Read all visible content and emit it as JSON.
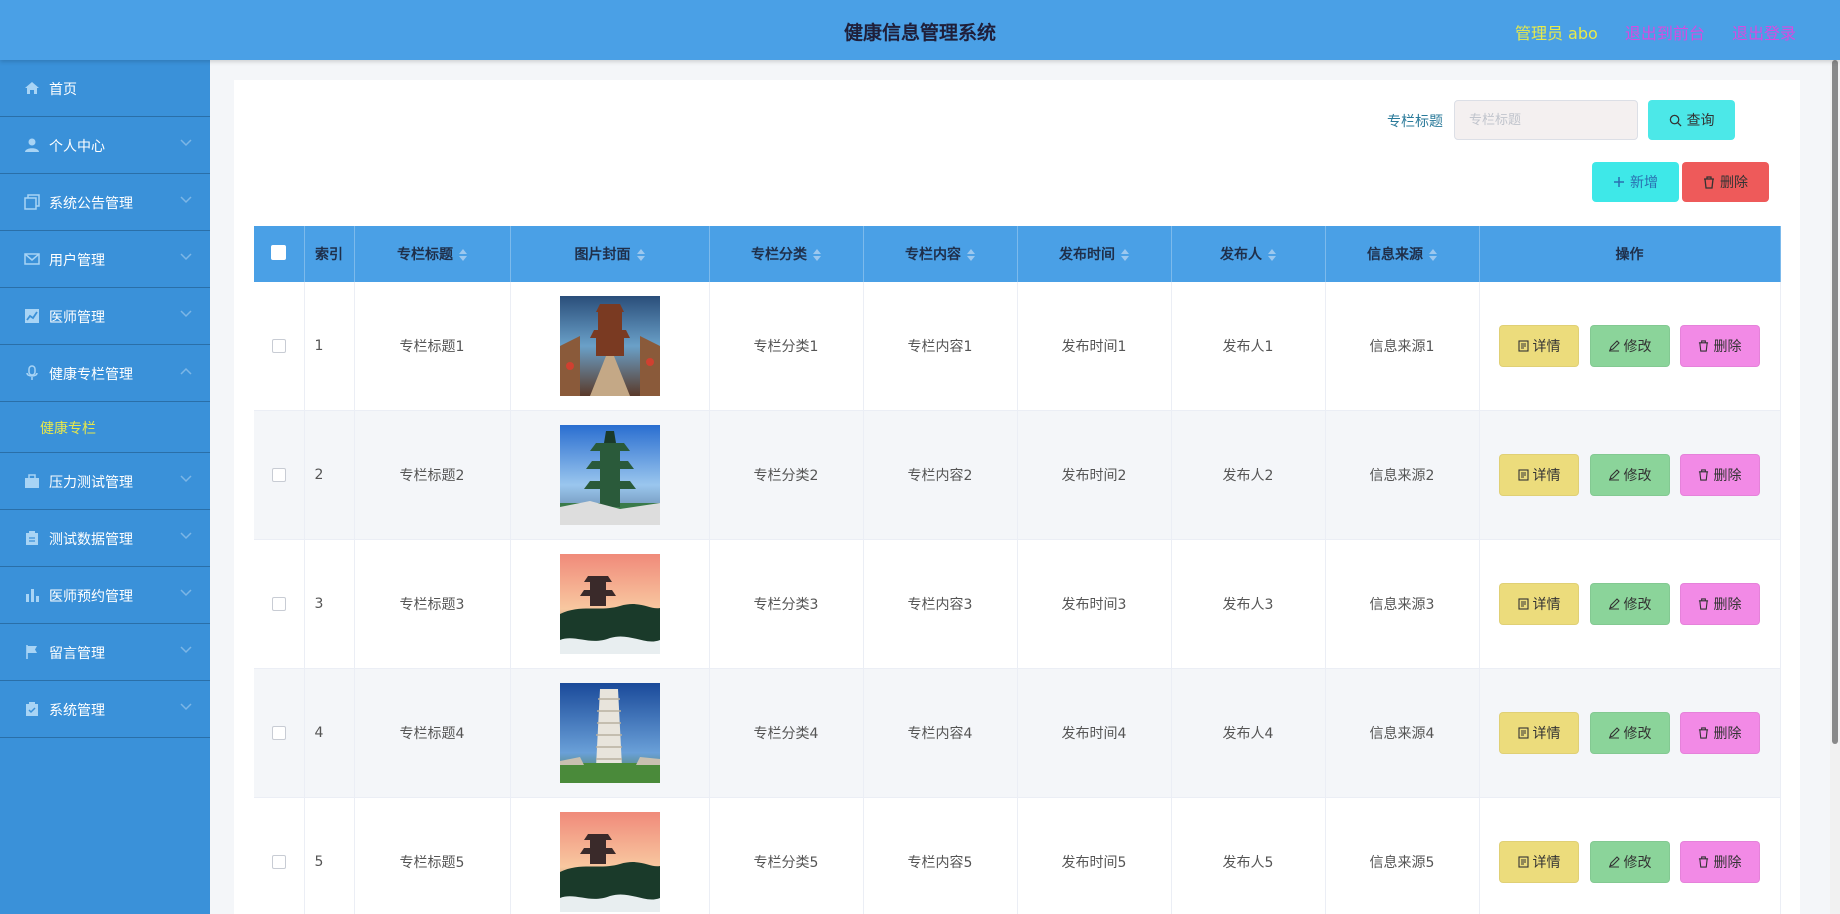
{
  "header": {
    "title": "健康信息管理系统",
    "admin": "管理员 abo",
    "front": "退出到前台",
    "logout": "退出登录"
  },
  "sidebar": {
    "items": [
      {
        "label": "首页",
        "icon": "home-icon"
      },
      {
        "label": "个人中心",
        "icon": "user-icon"
      },
      {
        "label": "系统公告管理",
        "icon": "document-icon"
      },
      {
        "label": "用户管理",
        "icon": "mail-icon"
      },
      {
        "label": "医师管理",
        "icon": "chart-icon"
      },
      {
        "label": "健康专栏管理",
        "icon": "microphone-icon"
      },
      {
        "label": "压力测试管理",
        "icon": "briefcase-icon"
      },
      {
        "label": "测试数据管理",
        "icon": "clipboard-icon"
      },
      {
        "label": "医师预约管理",
        "icon": "bar-chart-icon"
      },
      {
        "label": "留言管理",
        "icon": "flag-icon"
      },
      {
        "label": "系统管理",
        "icon": "check-clipboard-icon"
      }
    ],
    "sub_active": "健康专栏",
    "accent": "#e8e84a"
  },
  "search": {
    "label": "专栏标题",
    "placeholder": "专栏标题",
    "query_label": "查询"
  },
  "toolbar": {
    "add_label": "新增",
    "delete_label": "删除"
  },
  "table": {
    "columns": [
      "索引",
      "专栏标题",
      "图片封面",
      "专栏分类",
      "专栏内容",
      "发布时间",
      "发布人",
      "信息来源",
      "操作"
    ],
    "rows": [
      {
        "index": "1",
        "title": "专栏标题1",
        "category": "专栏分类1",
        "content": "专栏内容1",
        "time": "发布时间1",
        "publisher": "发布人1",
        "source": "信息来源1"
      },
      {
        "index": "2",
        "title": "专栏标题2",
        "category": "专栏分类2",
        "content": "专栏内容2",
        "time": "发布时间2",
        "publisher": "发布人2",
        "source": "信息来源2"
      },
      {
        "index": "3",
        "title": "专栏标题3",
        "category": "专栏分类3",
        "content": "专栏内容3",
        "time": "发布时间3",
        "publisher": "发布人3",
        "source": "信息来源3"
      },
      {
        "index": "4",
        "title": "专栏标题4",
        "category": "专栏分类4",
        "content": "专栏内容4",
        "time": "发布时间4",
        "publisher": "发布人4",
        "source": "信息来源4"
      },
      {
        "index": "5",
        "title": "专栏标题5",
        "category": "专栏分类5",
        "content": "专栏内容5",
        "time": "发布时间5",
        "publisher": "发布人5",
        "source": "信息来源5"
      }
    ],
    "actions": {
      "detail": "详情",
      "edit": "修改",
      "remove": "删除"
    }
  },
  "colors": {
    "header_bg": "#4aa0e6",
    "sidebar_bg": "#3a91d9",
    "detail_btn": "#ecdc7c",
    "edit_btn": "#8bd49a",
    "remove_btn": "#f28ae6"
  }
}
